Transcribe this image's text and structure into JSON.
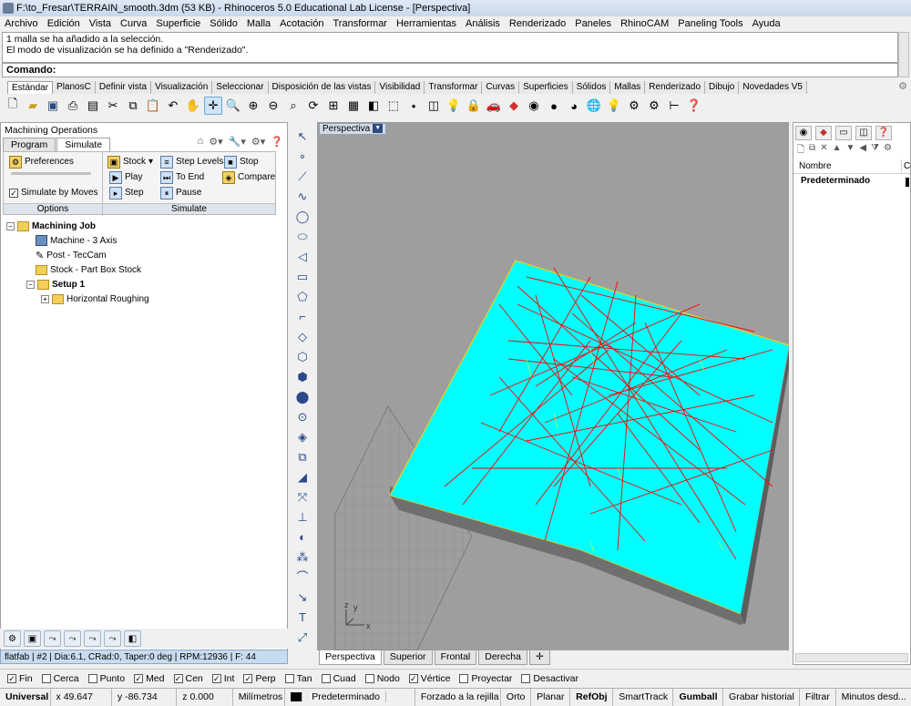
{
  "title": "F:\\to_Fresar\\TERRAIN_smooth.3dm (53 KB) - Rhinoceros 5.0 Educational Lab License - [Perspectiva]",
  "menu": [
    "Archivo",
    "Edición",
    "Vista",
    "Curva",
    "Superficie",
    "Sólido",
    "Malla",
    "Acotación",
    "Transformar",
    "Herramientas",
    "Análisis",
    "Renderizado",
    "Paneles",
    "RhinoCAM",
    "Paneling Tools",
    "Ayuda"
  ],
  "command_history": [
    "1 malla se ha añadido a la selección.",
    "El modo de visualización se ha definido a \"Renderizado\"."
  ],
  "command_label": "Comando:",
  "command_value": "",
  "toolbar_tabs": [
    "Estándar",
    "PlanosC",
    "Definir vista",
    "Visualización",
    "Seleccionar",
    "Disposición de las vistas",
    "Visibilidad",
    "Transformar",
    "Curvas",
    "Superficies",
    "Sólidos",
    "Mallas",
    "Renderizado",
    "Dibujo",
    "Novedades V5"
  ],
  "machining": {
    "panel_title": "Machining Operations",
    "tabs": [
      "Program",
      "Simulate"
    ],
    "preferences": "Preferences",
    "simulate_by_moves": "Simulate by Moves",
    "options_label": "Options",
    "stock": "Stock",
    "play": "Play",
    "step": "Step",
    "step_levels": "Step Levels",
    "to_end": "To End",
    "pause": "Pause",
    "stop": "Stop",
    "compare": "Compare",
    "simulate_label": "Simulate",
    "tree": {
      "job": "Machining Job",
      "machine": "Machine - 3 Axis",
      "post": "Post - TecCam",
      "stock": "Stock - Part Box Stock",
      "setup": "Setup 1",
      "op": "Horizontal Roughing"
    },
    "status": "flatfab | #2 | Dia:6.1, CRad:0, Taper:0 deg | RPM:12936 | F: 44"
  },
  "viewport": {
    "label": "Perspectiva",
    "tabs": [
      "Perspectiva",
      "Superior",
      "Frontal",
      "Derecha"
    ],
    "axis_x": "x",
    "axis_y": "y",
    "axis_z": "z"
  },
  "layers": {
    "col_name": "Nombre",
    "col_color": "Co",
    "row": "Predeterminado"
  },
  "osnaps": [
    {
      "label": "Fin",
      "checked": true
    },
    {
      "label": "Cerca",
      "checked": false
    },
    {
      "label": "Punto",
      "checked": false
    },
    {
      "label": "Med",
      "checked": true
    },
    {
      "label": "Cen",
      "checked": true
    },
    {
      "label": "Int",
      "checked": true
    },
    {
      "label": "Perp",
      "checked": true
    },
    {
      "label": "Tan",
      "checked": false
    },
    {
      "label": "Cuad",
      "checked": false
    },
    {
      "label": "Nodo",
      "checked": false
    },
    {
      "label": "Vértice",
      "checked": true
    },
    {
      "label": "Proyectar",
      "checked": false
    },
    {
      "label": "Desactivar",
      "checked": false
    }
  ],
  "status": {
    "cplane": "Universal",
    "x": "x 49.647",
    "y": "y -86.734",
    "z": "z 0.000",
    "units": "Milímetros",
    "layer": "Predeterminado",
    "grid_snap": "Forzado a la rejilla",
    "ortho": "Orto",
    "planar": "Planar",
    "refobj": "RefObj",
    "smarttrack": "SmartTrack",
    "gumball": "Gumball",
    "history": "Grabar historial",
    "filter": "Filtrar",
    "minutes": "Minutos desd..."
  },
  "colors": {
    "stock_top": "#00ffff",
    "toolpath": "#ff0000",
    "viewport_bg": "#9e9e9e"
  }
}
